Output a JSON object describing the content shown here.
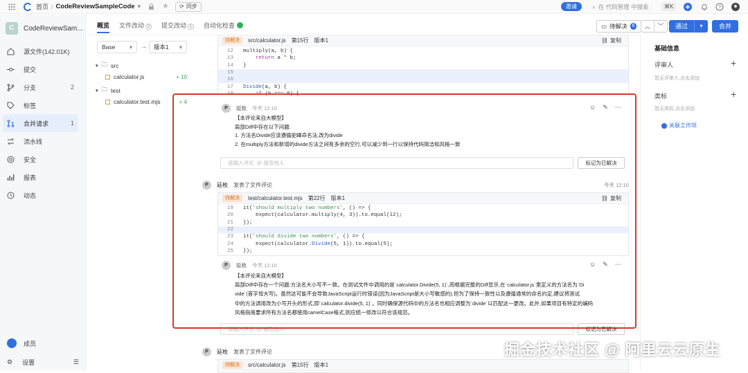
{
  "topbar": {
    "home": "首页",
    "repo": "CodeReviewSampleCode",
    "sync": "同步",
    "invite": "邀请",
    "search_placeholder": "在 代码管理 中搜索",
    "shortcut": "⌘K"
  },
  "sidebar": {
    "project": "CodeReviewSam...",
    "avatar": "C",
    "items": [
      {
        "label": "源文件(142.01K)",
        "icon": "home-icon"
      },
      {
        "label": "提交",
        "icon": "commit-icon"
      },
      {
        "label": "分支",
        "icon": "branch-icon",
        "count": "2"
      },
      {
        "label": "标签",
        "icon": "tag-icon"
      },
      {
        "label": "合并请求",
        "icon": "merge-request-icon",
        "count": "1",
        "active": true
      },
      {
        "label": "流水线",
        "icon": "pipeline-icon"
      },
      {
        "label": "安全",
        "icon": "security-icon"
      },
      {
        "label": "报表",
        "icon": "report-icon"
      },
      {
        "label": "动态",
        "icon": "activity-icon"
      }
    ],
    "members": "成员",
    "settings": "设置"
  },
  "tabs": {
    "overview": "概览",
    "files": "文件改动",
    "files_count": "2",
    "commits": "提交改动",
    "commits_count": "1",
    "checks": "自动化检查"
  },
  "toolbar": {
    "pending": "待解决",
    "pending_count": "6",
    "up": "︿",
    "down": "﹀",
    "pass": "通过",
    "merge": "合并"
  },
  "tree": {
    "base": "Base",
    "arrow": "→",
    "version": "版本1",
    "src": "src",
    "file1": "calculator.js",
    "file1_add": "+ 10",
    "test": "test",
    "file2": "calculator.test.mjs",
    "file2_add": "+ 4"
  },
  "right": {
    "title": "基础信息",
    "reviewer": "评审人",
    "reviewer_hint": "暂无评审人,点击添加",
    "label": "类标",
    "label_hint": "暂无类标,点击添加",
    "link": "关联工作项"
  },
  "card1": {
    "tag": "待解决",
    "path": "src/calculator.js",
    "line": "第15行",
    "ver": "版本1",
    "copy": "复制",
    "code": [
      [
        "12",
        "multiply(a, b) {"
      ],
      [
        "13",
        "    return a * b;"
      ],
      [
        "14",
        "}"
      ],
      [
        "15",
        ""
      ],
      [
        "16",
        ""
      ],
      [
        "17",
        "Divide(a, b) {"
      ],
      [
        "18",
        "    if (b === 0) {"
      ]
    ]
  },
  "comment1": {
    "avatar": "P",
    "author": "延枚",
    "time": "今天 12:10",
    "lines": [
      "【本评论来自大模型】",
      "局部Diff中存在以下问题:",
      "1. 方法名Divide应该遵循驼峰命名法,改为divide",
      "2. 在multiply方法和新增的divide方法之间有多余的空行,可以减少到一行以保持代码简洁和风格一致"
    ],
    "reply_placeholder": "请输入评论, @ 提及他人",
    "resolve": "标记为已解决"
  },
  "event1": {
    "avatar": "P",
    "author": "延枚",
    "action": "发表了文件评论",
    "time": "今天 12:10"
  },
  "card2": {
    "tag": "待解决",
    "path": "test/calculator.test.mjs",
    "line": "第22行",
    "ver": "版本1",
    "copy": "复制",
    "code": [
      [
        "19",
        "it('should multiply two numbers', () => {"
      ],
      [
        "20",
        "    expect(calculator.multiply(4, 3)).to.equal(12);"
      ],
      [
        "21",
        "});"
      ],
      [
        "22",
        ""
      ],
      [
        "23",
        "it('should divide two numbers', () => {"
      ],
      [
        "24",
        "    expect(calculator.Divide(5, 1)).to.equal(5);"
      ],
      [
        "25",
        "});"
      ]
    ]
  },
  "comment2": {
    "avatar": "P",
    "author": "延枚",
    "time": "今天 12:10",
    "lines": [
      "【本评论来自大模型】",
      "局部Diff中存在一个问题:方法名大小写不一致。在测试文件中调用的是`calculator.Divide(5, 1)`,而根据完整的Diff显示,在`calculator.js`里定义的方法名为`Di",
      "vide`(首字母大写)。虽然这可能不会导致JavaScript运行时错误(因为JavaScript是大小写敏感的),但为了保持一致性以及遵循通常的命名约定,建议将测试",
      "中的方法调用改为小写开头的形式,即`calculator.divide(5, 1)`。同时确保源代码中的方法名也相应调整为`divide`以匹配这一更改。此外,如果项目有特定的编码",
      "风格指南要求所有方法名都使用camelCase格式,则应统一修改以符合该规范。"
    ],
    "reply_placeholder": "请输入评论, @ 提及他人",
    "resolve": "标记为已解决"
  },
  "event2": {
    "avatar": "P",
    "author": "延枚",
    "action": "发表了文件评论"
  },
  "card3": {
    "tag": "待解决",
    "path": "src/calculator.js",
    "line": "第15行",
    "ver": "版本1"
  },
  "watermark": "掘金技术社区 @ 阿里云云原生",
  "colors": {
    "accent": "#2f6fe0",
    "tag_bg": "#fbe3d0",
    "tag_fg": "#d27a2c",
    "red_box": "#d9352b"
  }
}
